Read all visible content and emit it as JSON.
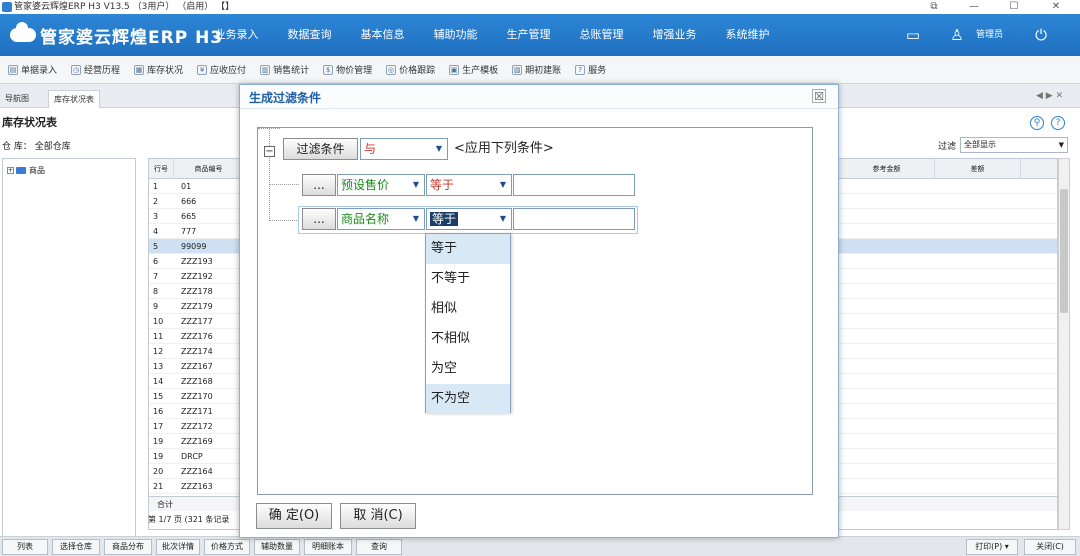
{
  "window": {
    "title": "管家婆云辉煌ERP H3 V13.5 （3用户） （启用） 【】",
    "controls": [
      "⧉",
      "—",
      "☐",
      "✕"
    ]
  },
  "header": {
    "logo": "管家婆云辉煌ERP H3",
    "menu": [
      "业务录入",
      "数据查询",
      "基本信息",
      "辅助功能",
      "生产管理",
      "总账管理",
      "增强业务",
      "系统维护"
    ],
    "admin": "管理员",
    "icons": [
      "message-icon",
      "user-icon",
      "power-icon"
    ]
  },
  "toolbar": {
    "items": [
      {
        "label": "单据录入",
        "icon": "document-icon"
      },
      {
        "label": "经营历程",
        "icon": "clock-icon"
      },
      {
        "label": "库存状况",
        "icon": "warehouse-icon"
      },
      {
        "label": "应收应付",
        "icon": "money-icon"
      },
      {
        "label": "销售统计",
        "icon": "chart-icon"
      },
      {
        "label": "物价管理",
        "icon": "price-icon"
      },
      {
        "label": "价格跟踪",
        "icon": "track-icon"
      },
      {
        "label": "生产模板",
        "icon": "factory-icon"
      },
      {
        "label": "期初建账",
        "icon": "book-icon"
      },
      {
        "label": "服务",
        "icon": "help-icon"
      }
    ]
  },
  "tabs": {
    "nav": "导航图",
    "stock": "库存状况表",
    "nav_arrows": "◀ ▶ ✕"
  },
  "report": {
    "title": "库存状况表",
    "warehouse": "仓 库： 全部仓库",
    "filter_label": "过滤",
    "filter_value": "全部显示",
    "tree_root": "商品",
    "columns": [
      "行号",
      "商品编号",
      "参考金额",
      "差额"
    ],
    "rows": [
      {
        "n": "1",
        "code": "01"
      },
      {
        "n": "2",
        "code": "666"
      },
      {
        "n": "3",
        "code": "665"
      },
      {
        "n": "4",
        "code": "777"
      },
      {
        "n": "5",
        "code": "99099"
      },
      {
        "n": "6",
        "code": "ZZZ193"
      },
      {
        "n": "7",
        "code": "ZZZ192"
      },
      {
        "n": "8",
        "code": "ZZZ178"
      },
      {
        "n": "9",
        "code": "ZZZ179"
      },
      {
        "n": "10",
        "code": "ZZZ177"
      },
      {
        "n": "11",
        "code": "ZZZ176"
      },
      {
        "n": "12",
        "code": "ZZZ174"
      },
      {
        "n": "13",
        "code": "ZZZ167"
      },
      {
        "n": "14",
        "code": "ZZZ168"
      },
      {
        "n": "15",
        "code": "ZZZ170"
      },
      {
        "n": "16",
        "code": "ZZZ171"
      },
      {
        "n": "17",
        "code": "ZZZ172"
      },
      {
        "n": "19",
        "code": "ZZZ169"
      },
      {
        "n": "19",
        "code": "DRCP"
      },
      {
        "n": "20",
        "code": "ZZZ164"
      },
      {
        "n": "21",
        "code": "ZZZ163"
      }
    ],
    "selected_row": 4,
    "sum_label": "合计",
    "pager": "第 1/7 页 (321 条记录"
  },
  "bottom": {
    "buttons": [
      "列表",
      "选择仓库",
      "商品分布",
      "批次详情",
      "价格方式",
      "辅助数量",
      "明细账本",
      "查询"
    ],
    "print": "打印(P) ▾",
    "close": "关闭(C)"
  },
  "dialog": {
    "title": "生成过滤条件",
    "close": "☒",
    "root_button": "过滤条件",
    "root_logic": "与",
    "apply_text": "<应用下列条件>",
    "conditions": [
      {
        "ellipsis": "...",
        "field": "预设售价",
        "op": "等于",
        "value": ""
      },
      {
        "ellipsis": "...",
        "field": "商品名称",
        "op": "等于",
        "value": ""
      }
    ],
    "dropdown_options": [
      "等于",
      "不等于",
      "相似",
      "不相似",
      "为空",
      "不为空"
    ],
    "ok": "确 定(O)",
    "cancel": "取 消(C)",
    "colors": {
      "logic": "#d9342b",
      "field": "#1a8a1a",
      "op": "#c0392b",
      "accent": "#1f5fa8"
    }
  }
}
